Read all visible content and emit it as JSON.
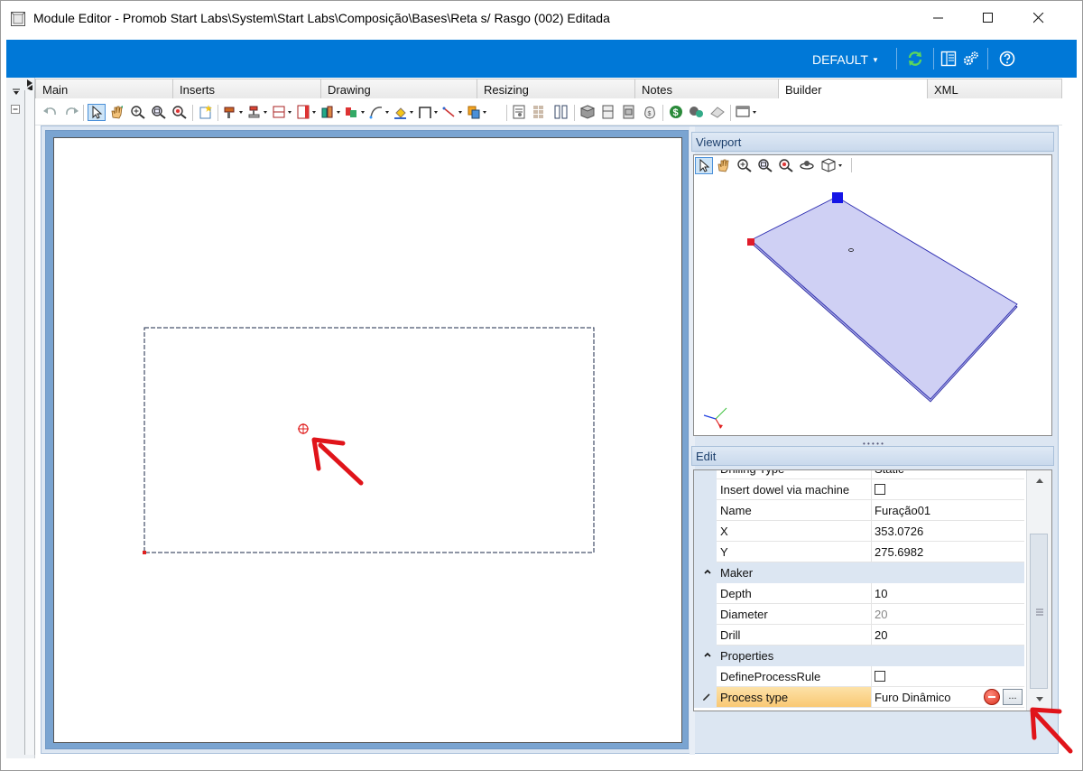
{
  "window": {
    "title": "Module Editor - Promob Start Labs\\System\\Start Labs\\Composição\\Bases\\Reta s/  Rasgo (002) Editada"
  },
  "topbar": {
    "profile_label": "DEFAULT",
    "accent_color": "#0078d7"
  },
  "tabs": [
    {
      "label": "Main",
      "active": false
    },
    {
      "label": "Inserts",
      "active": false
    },
    {
      "label": "Drawing",
      "active": false
    },
    {
      "label": "Resizing",
      "active": false
    },
    {
      "label": "Notes",
      "active": false
    },
    {
      "label": "Builder",
      "active": true
    },
    {
      "label": "XML",
      "active": false
    }
  ],
  "viewport": {
    "title": "Viewport"
  },
  "edit": {
    "title": "Edit",
    "rows": [
      {
        "type": "prop",
        "name": "Drilling Type",
        "value": "Static"
      },
      {
        "type": "prop",
        "name": "Insert dowel via machine",
        "value": "",
        "checkbox": true
      },
      {
        "type": "prop",
        "name": "Name",
        "value": "Furação01"
      },
      {
        "type": "prop",
        "name": "X",
        "value": "353.0726"
      },
      {
        "type": "prop",
        "name": "Y",
        "value": "275.6982"
      },
      {
        "type": "category",
        "name": "Maker"
      },
      {
        "type": "prop",
        "name": "Depth",
        "value": "10"
      },
      {
        "type": "prop",
        "name": "Diameter",
        "value": "20",
        "readonly": true
      },
      {
        "type": "prop",
        "name": "Drill",
        "value": "20"
      },
      {
        "type": "category",
        "name": "Properties"
      },
      {
        "type": "prop",
        "name": "DefineProcessRule",
        "value": "",
        "checkbox": true
      },
      {
        "type": "prop",
        "name": "Process type",
        "value": "Furo Dinâmico",
        "selected": true
      }
    ],
    "ellipsis_label": "..."
  }
}
